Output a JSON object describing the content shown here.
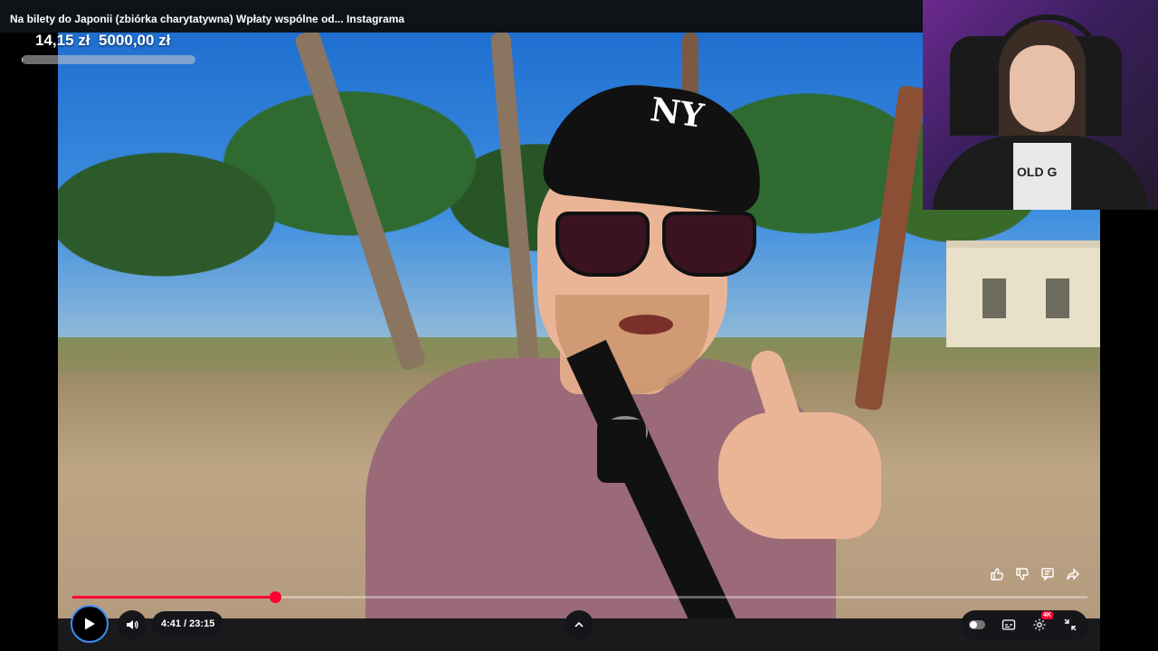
{
  "overlay": {
    "title": "Na bilety do Japonii (zbiórka charytatywna) Wpłaty wspólne od... Instagrama",
    "donation": {
      "current": "14,15 zł",
      "goal": "5000,00 zł",
      "progress": 0.003
    }
  },
  "player": {
    "time": "4:41 / 23:15",
    "progress_fraction": 0.2,
    "quality_badge": "4K"
  },
  "webcam": {
    "shirt_text": "OLD G"
  },
  "icons": {
    "play": "play-icon",
    "volume": "volume-icon",
    "chevron_up": "chevron-up-icon",
    "like": "thumbs-up-icon",
    "dislike": "thumbs-down-icon",
    "comment": "comment-icon",
    "share": "share-icon",
    "subtitles": "subtitles-icon",
    "settings": "gear-icon",
    "exit_fullscreen": "exit-fullscreen-icon"
  },
  "colors": {
    "progress": "#ff0033",
    "play_ring": "#3b8ff5"
  }
}
